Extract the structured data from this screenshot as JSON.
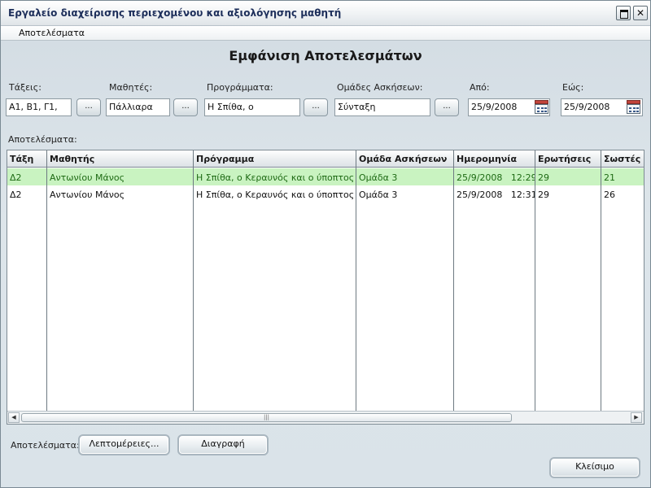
{
  "window": {
    "title": "Εργαλείο διαχείρισης περιεχομένου και αξιολόγησης μαθητή"
  },
  "menu": {
    "items": [
      "Αποτελέσματα"
    ]
  },
  "page": {
    "heading": "Εμφάνιση Αποτελεσμάτων"
  },
  "filters": {
    "classes": {
      "label": "Τάξεις:",
      "value": "Α1, Β1, Γ1,"
    },
    "students": {
      "label": "Μαθητές:",
      "value": "Πάλλιαρα"
    },
    "programs": {
      "label": "Προγράμματα:",
      "value": "Η Σπίθα, ο"
    },
    "groups": {
      "label": "Ομάδες Ασκήσεων:",
      "value": "Σύνταξη"
    },
    "from": {
      "label": "Από:",
      "value": "25/9/2008"
    },
    "to": {
      "label": "Εώς:",
      "value": "25/9/2008"
    },
    "browse_label": "..."
  },
  "results": {
    "label": "Αποτελέσματα:",
    "columns": [
      "Τάξη",
      "Μαθητής",
      "Πρόγραμμα",
      "Ομάδα Ασκήσεων",
      "Ημερομηνία",
      "Ερωτήσεις",
      "Σωστές"
    ],
    "rows": [
      [
        "Δ2",
        "Αντωνίου Μάνος",
        "Η Σπίθα, ο Κεραυνός και ο ύποπτος",
        "Ομάδα 3",
        "25/9/2008   12:29",
        "29",
        "21"
      ],
      [
        "Δ2",
        "Αντωνίου Μάνος",
        "Η Σπίθα, ο Κεραυνός και ο ύποπτος",
        "Ομάδα 3",
        "25/9/2008   12:31",
        "29",
        "26"
      ]
    ],
    "selected_row": 0
  },
  "actions": {
    "label": "Αποτελέσματα:",
    "details": "Λεπτομέρειες...",
    "delete": "Διαγραφή",
    "close": "Κλείσιμο"
  },
  "colors": {
    "selected_row": "#c9f3c1",
    "selected_text": "#1e6a14"
  }
}
